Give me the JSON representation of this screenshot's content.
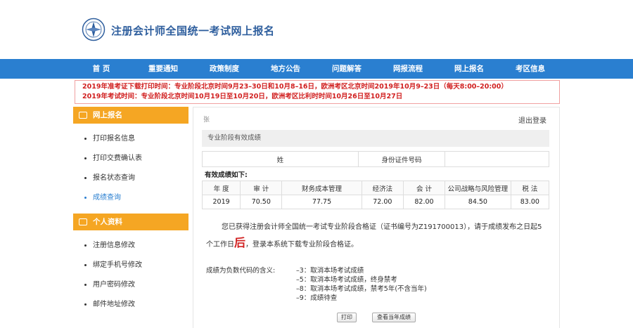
{
  "header": {
    "site_title": "注册会计师全国统一考试网上报名",
    "logo_icon": "cicpa-logo-icon"
  },
  "nav": [
    {
      "label": "首 页"
    },
    {
      "label": "重要通知"
    },
    {
      "label": "政策制度"
    },
    {
      "label": "地方公告"
    },
    {
      "label": "问题解答"
    },
    {
      "label": "网报流程"
    },
    {
      "label": "网上报名"
    },
    {
      "label": "考区信息"
    }
  ],
  "notice": {
    "line1": "2019年准考证下载打印时间：专业阶段北京时间9月23–30日和10月8–16日，欧洲考区北京时间2019年10月9–23日（每天8:00–20:00）",
    "line2": "2019年考试时间：专业阶段北京时间10月19日至10月20日，欧洲考区比利时时间10月26日至10月27日",
    "color": "#d12020"
  },
  "sidebar": {
    "section1": {
      "title": "网上报名",
      "items": [
        "打印报名信息",
        "打印交费确认表",
        "报名状态查询",
        "成绩查询"
      ]
    },
    "section2": {
      "title": "个人资料",
      "items": [
        "注册信息修改",
        "绑定手机号修改",
        "用户密码修改",
        "邮件地址修改"
      ]
    }
  },
  "main": {
    "top_text": "张",
    "logout": "退出登录",
    "sub_bar": "专业阶段有效成绩",
    "name_label": "姓",
    "id_label": "身份证件号码",
    "valid_label": "有效成绩如下:",
    "score_headers": [
      "年 度",
      "审 计",
      "财务成本管理",
      "经济法",
      "会 计",
      "公司战略与风险管理",
      "税 法"
    ],
    "score_row": [
      "2019",
      "70.50",
      "77.75",
      "72.00",
      "82.00",
      "84.50",
      "83.00"
    ],
    "cert_text_1": "您已获得注册会计师全国统一考试专业阶段合格证（证书编号为Z191700013），请于成绩发布之日起5个工作日",
    "cert_big": "后",
    "cert_text_2": "，登录本系统下载专业阶段合格证。",
    "codes_label": "成绩为负数代码的含义:",
    "codes": [
      "–3：取消本场考试成绩",
      "–5：取消本场考试成绩，终身禁考",
      "–8：取消本场考试成绩，禁考5年(不含当年)",
      "–9：成绩待查"
    ],
    "print_button": "打印",
    "view_button": "查看当年成绩"
  },
  "colors": {
    "nav_bg": "#2a7fd0",
    "side_head": "#f5a623",
    "accent_blue": "#2a7fd0"
  }
}
